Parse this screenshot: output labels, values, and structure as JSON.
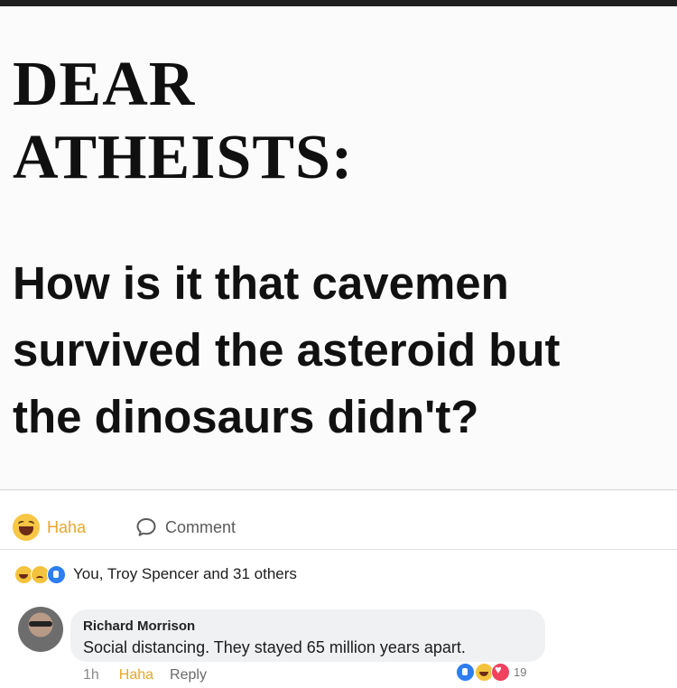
{
  "post": {
    "headline_line1": "DEAR",
    "headline_line2": "ATHEISTS:",
    "question_line1": "How is it that cavemen",
    "question_line2": "survived the asteroid but",
    "question_line3": "the dinosaurs didn't?"
  },
  "actions": {
    "haha_label": "Haha",
    "comment_label": "Comment"
  },
  "reactions_summary": {
    "text": "You, Troy Spencer and 31 others",
    "icons": [
      "haha-icon",
      "sad-icon",
      "like-icon"
    ]
  },
  "comment": {
    "author": "Richard Morrison",
    "text": "Social distancing. They stayed 65 million years apart.",
    "time": "1h",
    "haha_label": "Haha",
    "reply_label": "Reply",
    "reaction_count": "19",
    "reaction_icons": [
      "like-icon",
      "haha-icon",
      "love-icon"
    ]
  },
  "colors": {
    "haha": "#e7a72c",
    "like": "#2d7ef0",
    "love": "#f0415f",
    "bubble": "#f0f1f3"
  }
}
